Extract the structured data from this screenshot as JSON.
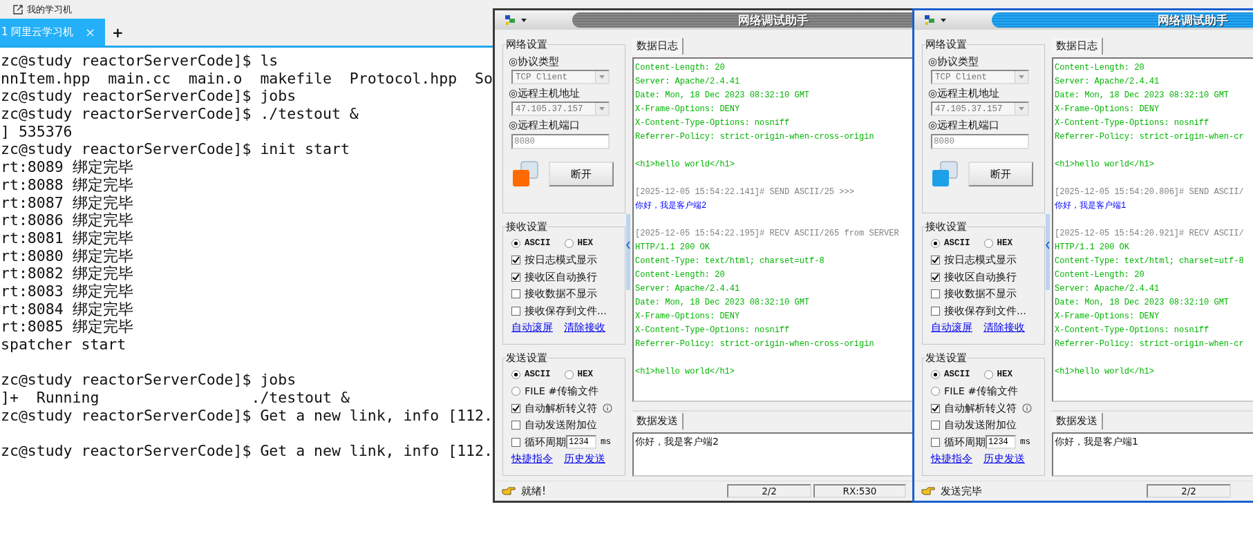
{
  "terminal": {
    "top_bar": {
      "title": "我的学习机"
    },
    "tabs": [
      {
        "label": "1 阿里云学习机",
        "selected": true,
        "close": "×"
      }
    ],
    "new_tab": "+",
    "lines": [
      {
        "kind": "line",
        "text": "zc@study reactorServerCode]$ ls"
      },
      {
        "kind": "line",
        "text": "nnItem.hpp  main.cc  main.o  makefile  Protocol.hpp  So"
      },
      {
        "kind": "line",
        "text": "zc@study reactorServerCode]$ jobs"
      },
      {
        "kind": "line",
        "text": "zc@study reactorServerCode]$ ./testout &"
      },
      {
        "kind": "line",
        "text": "] 535376"
      },
      {
        "kind": "line",
        "text": "zc@study reactorServerCode]$ init start"
      },
      {
        "kind": "line",
        "text": "rt:8089 绑定完毕"
      },
      {
        "kind": "line",
        "text": "rt:8088 绑定完毕"
      },
      {
        "kind": "line",
        "text": "rt:8087 绑定完毕"
      },
      {
        "kind": "line",
        "text": "rt:8086 绑定完毕"
      },
      {
        "kind": "line",
        "text": "rt:8081 绑定完毕"
      },
      {
        "kind": "line",
        "text": "rt:8080 绑定完毕"
      },
      {
        "kind": "line",
        "text": "rt:8082 绑定完毕"
      },
      {
        "kind": "line",
        "text": "rt:8083 绑定完毕"
      },
      {
        "kind": "line",
        "text": "rt:8084 绑定完毕"
      },
      {
        "kind": "line",
        "text": "rt:8085 绑定完毕"
      },
      {
        "kind": "line",
        "text": "spatcher start"
      },
      {
        "kind": "blank"
      },
      {
        "kind": "line",
        "text": "zc@study reactorServerCode]$ jobs"
      },
      {
        "kind": "line",
        "text": "]+  Running                 ./testout &"
      },
      {
        "kind": "line",
        "text": "zc@study reactorServerCode]$ Get a new link, info [112."
      },
      {
        "kind": "blank"
      },
      {
        "kind": "line",
        "text": "zc@study reactorServerCode]$ Get a new link, info [112."
      }
    ]
  },
  "windows": [
    {
      "title": "网络调试助手",
      "active": false,
      "network_settings": {
        "title": "网络设置",
        "protocol_label": "◎协议类型",
        "protocol": "TCP Client",
        "host_label": "◎远程主机地址",
        "host": "47.105.37.157",
        "port_label": "◎远程主机端口",
        "port": "8080",
        "indicator": {
          "color": "#ff6a00"
        },
        "connect_button": "断开"
      },
      "receive_settings": {
        "title": "接收设置",
        "modes": [
          {
            "label": "ASCII",
            "selected": true
          },
          {
            "label": "HEX",
            "selected": false
          }
        ],
        "options": [
          {
            "label": "按日志模式显示",
            "checked": true
          },
          {
            "label": "接收区自动换行",
            "checked": true
          },
          {
            "label": "接收数据不显示",
            "checked": false
          },
          {
            "label": "接收保存到文件...",
            "checked": false
          }
        ],
        "links": [
          "自动滚屏",
          "清除接收"
        ]
      },
      "send_settings": {
        "title": "发送设置",
        "modes": [
          {
            "label": "ASCII",
            "selected": true
          },
          {
            "label": "HEX",
            "selected": false
          }
        ],
        "file_option": {
          "label": "FILE #传输文件",
          "selected": false
        },
        "options": [
          {
            "kind": "info",
            "label": "自动解析转义符",
            "checked": true
          },
          {
            "kind": "plain",
            "label": "自动发送附加位",
            "checked": false
          },
          {
            "kind": "interval",
            "label": "循环周期",
            "checked": false,
            "interval": "1234",
            "unit": "ms"
          }
        ],
        "links": [
          "快捷指令",
          "历史发送"
        ]
      },
      "log_tab": "数据日志",
      "log": [
        {
          "kind": "response",
          "text": "Content-Length: 20"
        },
        {
          "kind": "response",
          "text": "Server: Apache/2.4.41"
        },
        {
          "kind": "response",
          "text": "Date: Mon, 18 Dec 2023 08:32:10 GMT"
        },
        {
          "kind": "response",
          "text": "X-Frame-Options: DENY"
        },
        {
          "kind": "response",
          "text": "X-Content-Type-Options: nosniff"
        },
        {
          "kind": "response",
          "text": "Referrer-Policy: strict-origin-when-cross-origin"
        },
        {
          "kind": "gap"
        },
        {
          "kind": "response",
          "text": "<h1>hello world</h1>"
        },
        {
          "kind": "gap"
        },
        {
          "kind": "meta",
          "text": "[2025-12-05 15:54:22.141]# SEND ASCII/25 >>>"
        },
        {
          "kind": "message",
          "text": "你好，我是客户端2"
        },
        {
          "kind": "gap"
        },
        {
          "kind": "meta",
          "text": "[2025-12-05 15:54:22.195]# RECV ASCII/265 from SERVER"
        },
        {
          "kind": "response",
          "text": "HTTP/1.1 200 OK"
        },
        {
          "kind": "response",
          "text": "Content-Type: text/html; charset=utf-8"
        },
        {
          "kind": "response",
          "text": "Content-Length: 20"
        },
        {
          "kind": "response",
          "text": "Server: Apache/2.4.41"
        },
        {
          "kind": "response",
          "text": "Date: Mon, 18 Dec 2023 08:32:10 GMT"
        },
        {
          "kind": "response",
          "text": "X-Frame-Options: DENY"
        },
        {
          "kind": "response",
          "text": "X-Content-Type-Options: nosniff"
        },
        {
          "kind": "response",
          "text": "Referrer-Policy: strict-origin-when-cross-origin"
        },
        {
          "kind": "gap"
        },
        {
          "kind": "response",
          "text": "<h1>hello world</h1>"
        }
      ],
      "send_tab": "数据发送",
      "send_text": "你好，我是客户端2",
      "status": {
        "message": "就绪!",
        "fields": [
          "2/2",
          "RX:530"
        ]
      }
    },
    {
      "title": "网络调试助手",
      "active": true,
      "network_settings": {
        "title": "网络设置",
        "protocol_label": "◎协议类型",
        "protocol": "TCP Client",
        "host_label": "◎远程主机地址",
        "host": "47.105.37.157",
        "port_label": "◎远程主机端口",
        "port": "8080",
        "indicator": {
          "color": "#1ea0e8"
        },
        "connect_button": "断开"
      },
      "receive_settings": {
        "title": "接收设置",
        "modes": [
          {
            "label": "ASCII",
            "selected": true
          },
          {
            "label": "HEX",
            "selected": false
          }
        ],
        "options": [
          {
            "label": "按日志模式显示",
            "checked": true
          },
          {
            "label": "接收区自动换行",
            "checked": true
          },
          {
            "label": "接收数据不显示",
            "checked": false
          },
          {
            "label": "接收保存到文件...",
            "checked": false
          }
        ],
        "links": [
          "自动滚屏",
          "清除接收"
        ]
      },
      "send_settings": {
        "title": "发送设置",
        "modes": [
          {
            "label": "ASCII",
            "selected": true
          },
          {
            "label": "HEX",
            "selected": false
          }
        ],
        "file_option": {
          "label": "FILE #传输文件",
          "selected": false
        },
        "options": [
          {
            "kind": "info",
            "label": "自动解析转义符",
            "checked": true
          },
          {
            "kind": "plain",
            "label": "自动发送附加位",
            "checked": false
          },
          {
            "kind": "interval",
            "label": "循环周期",
            "checked": false,
            "interval": "1234",
            "unit": "ms"
          }
        ],
        "links": [
          "快捷指令",
          "历史发送"
        ]
      },
      "log_tab": "数据日志",
      "log": [
        {
          "kind": "response",
          "text": "Content-Length: 20"
        },
        {
          "kind": "response",
          "text": "Server: Apache/2.4.41"
        },
        {
          "kind": "response",
          "text": "Date: Mon, 18 Dec 2023 08:32:10 GMT"
        },
        {
          "kind": "response",
          "text": "X-Frame-Options: DENY"
        },
        {
          "kind": "response",
          "text": "X-Content-Type-Options: nosniff"
        },
        {
          "kind": "response",
          "text": "Referrer-Policy: strict-origin-when-cr"
        },
        {
          "kind": "gap"
        },
        {
          "kind": "response",
          "text": "<h1>hello world</h1>"
        },
        {
          "kind": "gap"
        },
        {
          "kind": "meta",
          "text": "[2025-12-05 15:54:20.806]# SEND ASCII/"
        },
        {
          "kind": "message",
          "text": "你好，我是客户端1"
        },
        {
          "kind": "gap"
        },
        {
          "kind": "meta",
          "text": "[2025-12-05 15:54:20.921]# RECV ASCII/"
        },
        {
          "kind": "response",
          "text": "HTTP/1.1 200 OK"
        },
        {
          "kind": "response",
          "text": "Content-Type: text/html; charset=utf-8"
        },
        {
          "kind": "response",
          "text": "Content-Length: 20"
        },
        {
          "kind": "response",
          "text": "Server: Apache/2.4.41"
        },
        {
          "kind": "response",
          "text": "Date: Mon, 18 Dec 2023 08:32:10 GMT"
        },
        {
          "kind": "response",
          "text": "X-Frame-Options: DENY"
        },
        {
          "kind": "response",
          "text": "X-Content-Type-Options: nosniff"
        },
        {
          "kind": "response",
          "text": "Referrer-Policy: strict-origin-when-cr"
        },
        {
          "kind": "gap"
        },
        {
          "kind": "response",
          "text": "<h1>hello world</h1>"
        }
      ],
      "send_tab": "数据发送",
      "send_text": "你好，我是客户端1",
      "status": {
        "message": "发送完毕",
        "fields": [
          "2/2"
        ]
      }
    }
  ]
}
